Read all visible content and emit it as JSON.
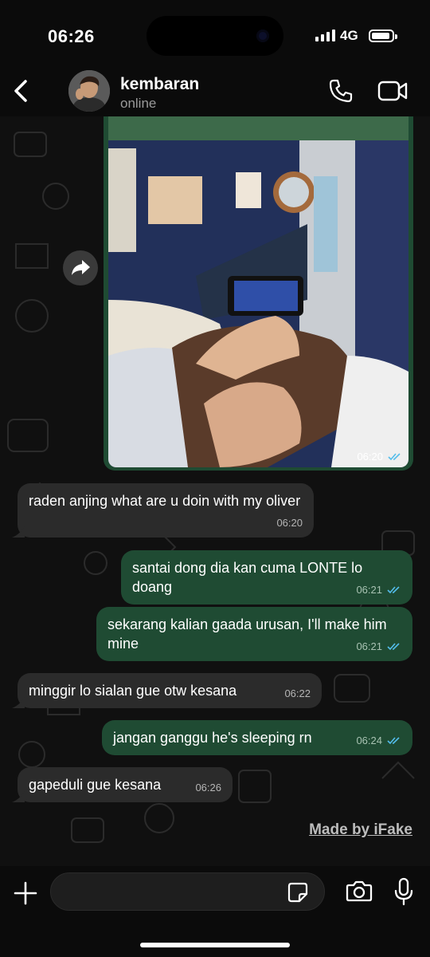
{
  "status_bar": {
    "time": "06:26",
    "network": "4G"
  },
  "header": {
    "contact_name": "kembaran",
    "presence": "online"
  },
  "photo_message": {
    "time": "06:20"
  },
  "messages": [
    {
      "text": "raden anjing what are u doin with my oliver",
      "time": "06:20"
    },
    {
      "text": "santai dong dia kan cuma LONTE lo doang",
      "time": "06:21"
    },
    {
      "text": "sekarang kalian gaada urusan, I'll make him mine",
      "time": "06:21"
    },
    {
      "text": "minggir lo sialan gue otw kesana",
      "time": "06:22"
    },
    {
      "text": "jangan ganggu he's sleeping rn",
      "time": "06:24"
    },
    {
      "text": "gapeduli gue kesana",
      "time": "06:26"
    }
  ],
  "watermark": "Made by iFake",
  "composer": {
    "value": "",
    "placeholder": ""
  },
  "colors": {
    "outgoing_bubble": "#1f4b33",
    "incoming_bubble": "#2b2b2b",
    "read_ticks": "#53bdeb",
    "background": "#101010"
  },
  "icons": [
    "back-chevron-icon",
    "phone-icon",
    "video-call-icon",
    "forward-icon",
    "plus-icon",
    "sticker-icon",
    "camera-icon",
    "microphone-icon"
  ]
}
